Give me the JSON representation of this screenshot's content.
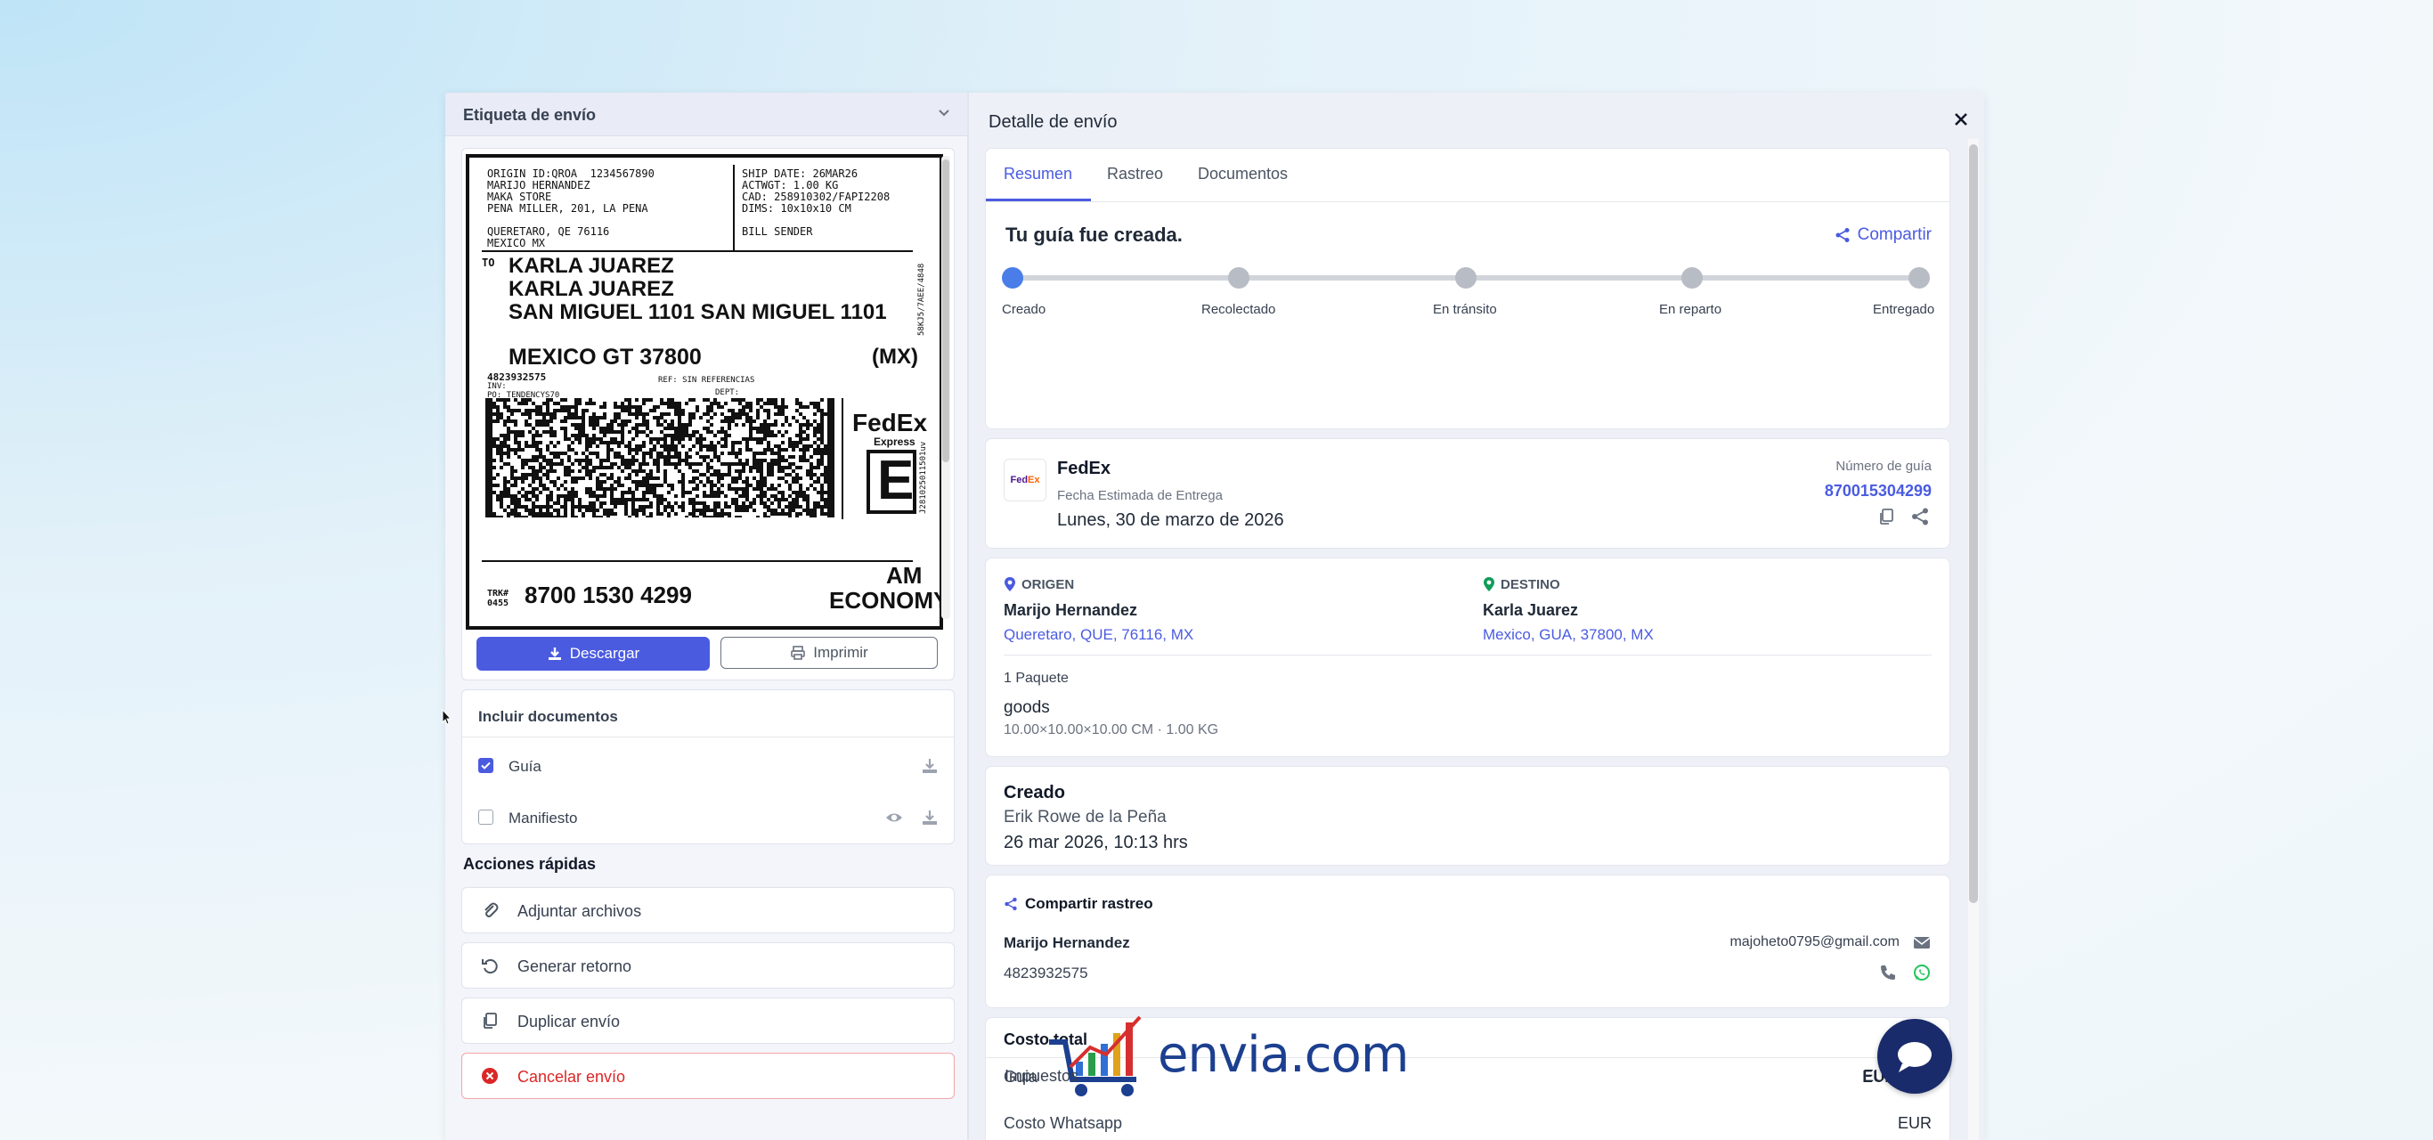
{
  "left": {
    "header_title": "Etiqueta de envío",
    "label": {
      "origin_block": "ORIGIN ID:QROA  1234567890\nMARIJO HERNANDEZ\nMAKA STORE\nPENA MILLER, 201, LA PENA\n\nQUERETARO, QE 76116\nMEXICO MX",
      "ship_block": "SHIP DATE: 26MAR26\nACTWGT: 1.00 KG\nCAD: 258910302/FAPI2208\nDIMS: 10x10x10 CM\n\nBILL SENDER",
      "to_label": "TO",
      "to_line1": "KARLA JUAREZ",
      "to_line2": "KARLA JUAREZ",
      "to_line3": "SAN MIGUEL 1101 SAN MIGUEL 1101",
      "to_city": "MEXICO GT 37800",
      "to_country": "(MX)",
      "phone": "4823932575",
      "inv": "INV:\nPO: TENDENCYS70",
      "ref": "REF: SIN REFERENCIAS",
      "dept": "DEPT:",
      "fedex": "FedEx",
      "express": "Express",
      "service_letter": "E",
      "trk_label": "TRK#\n0455",
      "tracking": "8700 1530 4299",
      "am": "AM",
      "economy": "ECONOMY",
      "side_code": "58KJ5/7AEE/4848",
      "side_code2": "J281025011501uv"
    },
    "download_label": "Descargar",
    "print_label": "Imprimir",
    "docs": {
      "title": "Incluir documentos",
      "items": [
        {
          "label": "Guía",
          "checked": true
        },
        {
          "label": "Manifiesto",
          "checked": false
        }
      ]
    },
    "quick_actions": {
      "title": "Acciones rápidas",
      "items": [
        {
          "label": "Adjuntar archivos",
          "icon": "paperclip-icon"
        },
        {
          "label": "Generar retorno",
          "icon": "undo-icon"
        },
        {
          "label": "Duplicar envío",
          "icon": "copy-icon"
        },
        {
          "label": "Cancelar envío",
          "icon": "cancel-icon"
        }
      ]
    }
  },
  "right": {
    "title": "Detalle de envío",
    "tabs": [
      {
        "label": "Resumen",
        "active": true
      },
      {
        "label": "Rastreo",
        "active": false
      },
      {
        "label": "Documentos",
        "active": false
      }
    ],
    "created_title": "Tu guía fue creada.",
    "share_label": "Compartir",
    "progress": {
      "current_step": 0,
      "steps": [
        "Creado",
        "Recolectado",
        "En tránsito",
        "En reparto",
        "Entregado"
      ]
    },
    "carrier": {
      "name": "FedEx",
      "eta_label": "Fecha Estimada de Entrega",
      "eta_value": "Lunes, 30 de marzo de 2026",
      "guide_label": "Número de guía",
      "guide_number": "870015304299"
    },
    "origin": {
      "heading": "ORIGEN",
      "name": "Marijo Hernandez",
      "address": "Queretaro, QUE, 76116, MX"
    },
    "destination": {
      "heading": "DESTINO",
      "name": "Karla Juarez",
      "address": "Mexico, GUA, 37800, MX"
    },
    "package": {
      "count": "1 Paquete",
      "name": "goods",
      "dims": "10.00×10.00×10.00 CM · 1.00 KG"
    },
    "created": {
      "title": "Creado",
      "user": "Erik Rowe de la Peña",
      "date": "26 mar 2026, 10:13 hrs"
    },
    "share_tracking": {
      "title": "Compartir rastreo",
      "name": "Marijo Hernandez",
      "phone": "4823932575",
      "email": "majoheto0795@gmail.com"
    },
    "cost": {
      "title": "Costo total",
      "rows": [
        {
          "label": "Guia",
          "value": "EUR 7.76"
        },
        {
          "label": "Costo Whatsapp",
          "value": "EUR"
        },
        {
          "label": "Impuestos",
          "value": "EUR"
        }
      ]
    }
  },
  "brand": "envia.com",
  "colors": {
    "accent": "#4a5be0",
    "danger": "#dc2626",
    "fab": "#1a2b6b",
    "whatsapp": "#22c55e",
    "destination_pin": "#0f9d58"
  }
}
